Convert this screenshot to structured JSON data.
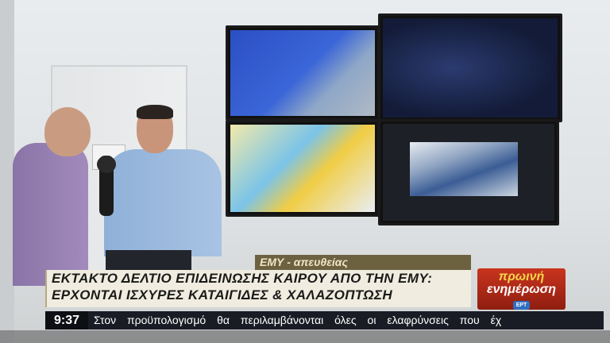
{
  "lower_third": {
    "tag": "ΕΜΥ - απευθείας",
    "headline_line1": "ΕΚΤΑΚΤΟ ΔΕΛΤΙΟ ΕΠΙΔΕΙΝΩΣΗΣ ΚΑΙΡΟΥ ΑΠΟ ΤΗΝ ΕΜΥ:",
    "headline_line2": "ΕΡΧΟΝΤΑΙ ΙΣΧΥΡΕΣ ΚΑΤΑΙΓΙΔΕΣ & ΧΑΛΑΖΟΠΤΩΣΗ"
  },
  "brand": {
    "line1": "πρωινή",
    "line2": "ενημέρωση",
    "logo": "ΕΡΤ",
    "color": "#c9341e"
  },
  "ticker": {
    "time": "9:37",
    "text": "Στον προϋπολογισμό θα περιλαμβάνονται όλες οι ελαφρύνσεις που έχ"
  }
}
